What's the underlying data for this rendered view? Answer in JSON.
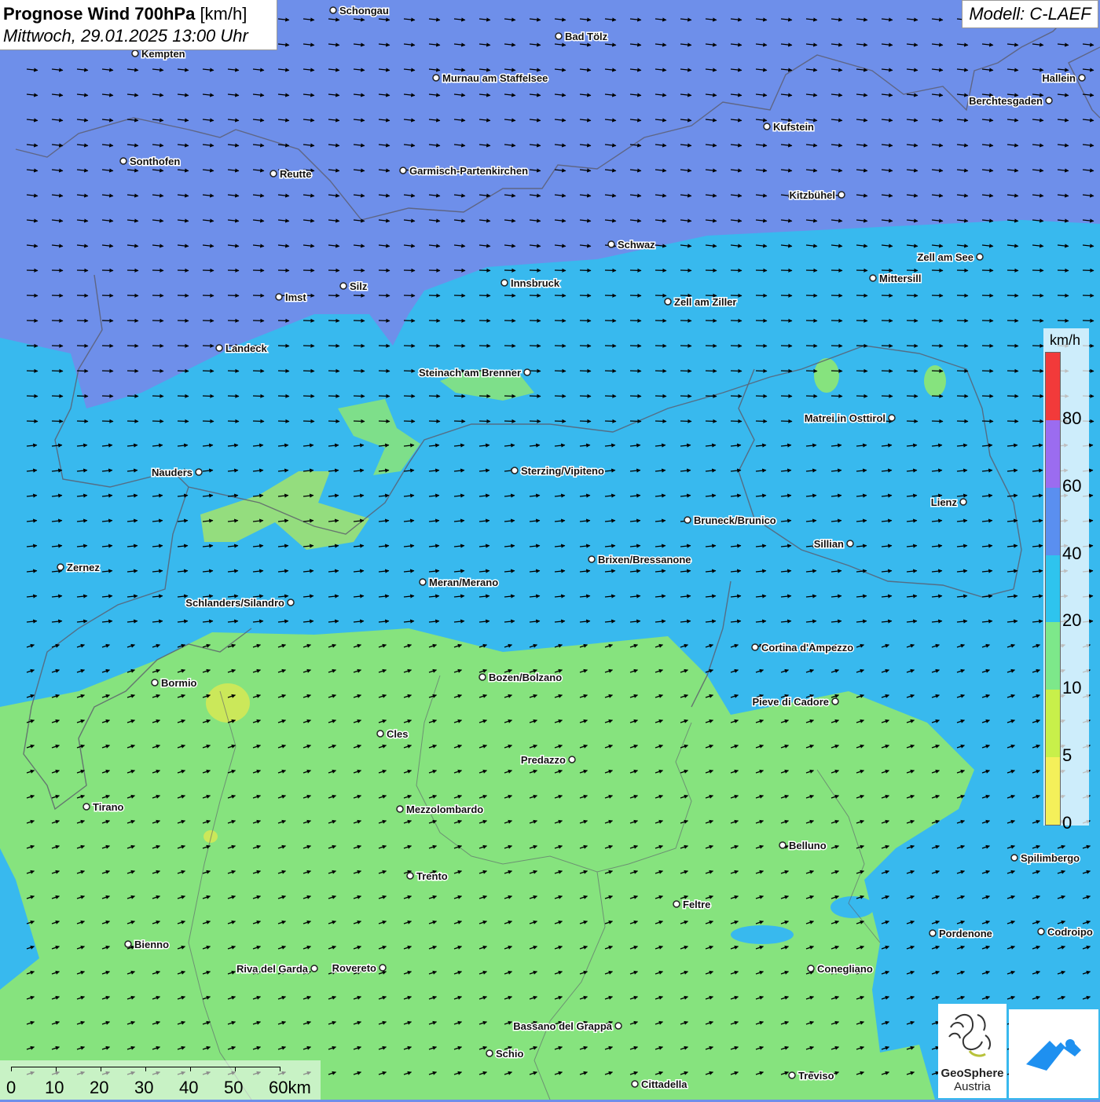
{
  "title": {
    "main": "Prognose Wind 700hPa",
    "unit": "[km/h]",
    "datetime": "Mittwoch, 29.01.2025 13:00 Uhr"
  },
  "model": "Modell: C-LAEF",
  "legend": {
    "unit": "km/h",
    "ticks": [
      "80",
      "60",
      "40",
      "20",
      "10",
      "5",
      "0"
    ],
    "colors": [
      "#f23a3a",
      "#9b6cf0",
      "#5a8ff0",
      "#2ec4ee",
      "#7de88a",
      "#c8f04a",
      "#f4f05a"
    ]
  },
  "scale": {
    "labels": [
      "0",
      "10",
      "20",
      "30",
      "40",
      "50",
      "60km"
    ]
  },
  "logos": {
    "geosphere_line1": "GeoSphere",
    "geosphere_line2": "Austria"
  },
  "cities": [
    {
      "name": "Schongau"
    },
    {
      "name": "Bad Tölz"
    },
    {
      "name": "Kempten"
    },
    {
      "name": "Murnau am Staffelsee"
    },
    {
      "name": "Hallein"
    },
    {
      "name": "Berchtesgaden"
    },
    {
      "name": "Kufstein"
    },
    {
      "name": "Sonthofen"
    },
    {
      "name": "Reutte"
    },
    {
      "name": "Garmisch-Partenkirchen"
    },
    {
      "name": "Kitzbühel"
    },
    {
      "name": "Schwaz"
    },
    {
      "name": "Zell am See"
    },
    {
      "name": "Innsbruck"
    },
    {
      "name": "Mittersill"
    },
    {
      "name": "Silz"
    },
    {
      "name": "Imst"
    },
    {
      "name": "Zell am Ziller"
    },
    {
      "name": "Landeck"
    },
    {
      "name": "Steinach am Brenner"
    },
    {
      "name": "Matrei in Osttirol"
    },
    {
      "name": "Nauders"
    },
    {
      "name": "Sterzing/Vipiteno"
    },
    {
      "name": "Lienz"
    },
    {
      "name": "Bruneck/Brunico"
    },
    {
      "name": "Sillian"
    },
    {
      "name": "Zernez"
    },
    {
      "name": "Brixen/Bressanone"
    },
    {
      "name": "Meran/Merano"
    },
    {
      "name": "Schlanders/Silandro"
    },
    {
      "name": "Cortina d'Ampezzo"
    },
    {
      "name": "Bozen/Bolzano"
    },
    {
      "name": "Bormio"
    },
    {
      "name": "Pieve di Cadore"
    },
    {
      "name": "Cles"
    },
    {
      "name": "Predazzo"
    },
    {
      "name": "Tirano"
    },
    {
      "name": "Mezzolombardo"
    },
    {
      "name": "Belluno"
    },
    {
      "name": "Spilimbergo"
    },
    {
      "name": "Trento"
    },
    {
      "name": "Feltre"
    },
    {
      "name": "Pordenone"
    },
    {
      "name": "Codroipo"
    },
    {
      "name": "Bienno"
    },
    {
      "name": "Riva del Garda"
    },
    {
      "name": "Rovereto"
    },
    {
      "name": "Conegliano"
    },
    {
      "name": "Bassano del Grappa"
    },
    {
      "name": "Schio"
    },
    {
      "name": "Treviso"
    },
    {
      "name": "Cittadella"
    }
  ]
}
